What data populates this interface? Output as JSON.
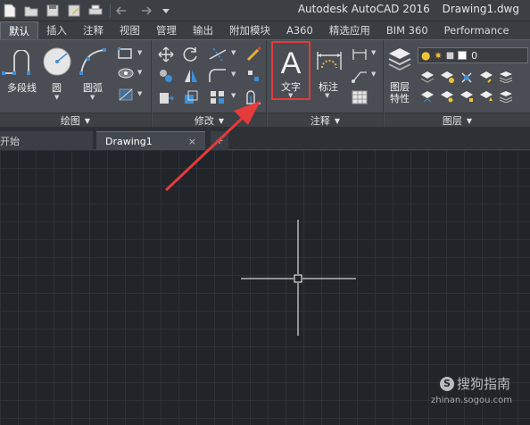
{
  "window": {
    "app_name": "Autodesk AutoCAD 2016",
    "document": "Drawing1.dwg"
  },
  "quick_access": [
    "new-icon",
    "open-icon",
    "save-icon",
    "saveas-icon",
    "print-icon",
    "undo-icon",
    "redo-icon",
    "dropdown-icon"
  ],
  "ribbon_tabs": [
    "默认",
    "插入",
    "注释",
    "视图",
    "管理",
    "输出",
    "附加模块",
    "A360",
    "精选应用",
    "BIM 360",
    "Performance"
  ],
  "active_tab": "默认",
  "panels": {
    "draw": {
      "title": "绘图",
      "polyline_label": "多段线",
      "circle_label": "圆",
      "arc_label": "圆弧"
    },
    "modify": {
      "title": "修改"
    },
    "annotation": {
      "title": "注释",
      "text_label": "文字",
      "dimension_label": "标注"
    },
    "layers": {
      "title": "图层",
      "properties_label_1": "图层",
      "properties_label_2": "特性",
      "current_layer": "0"
    }
  },
  "file_tabs": {
    "start": "开始",
    "drawing": "Drawing1",
    "close_glyph": "×",
    "plus_glyph": "+"
  },
  "watermark": {
    "brand": "搜狗指南",
    "url": "zhinan.sogou.com"
  },
  "colors": {
    "highlight": "#e43b3b",
    "arrow": "#e43b3b",
    "accent_blue": "#3d8fd6",
    "yellow": "#f0c23a"
  }
}
